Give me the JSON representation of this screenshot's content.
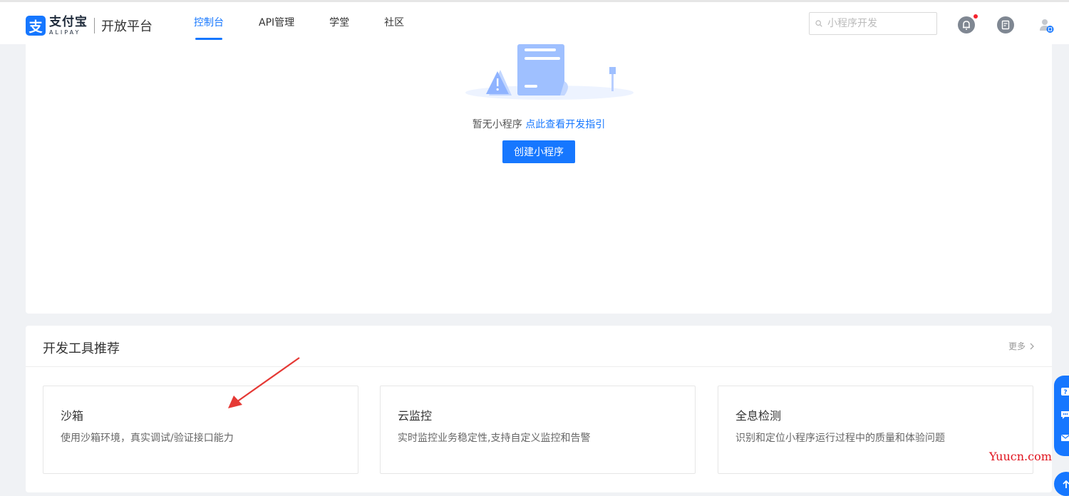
{
  "header": {
    "logo": {
      "cn": "支付宝",
      "en": "ALIPAY",
      "mark": "支",
      "platform": "开放平台"
    },
    "nav": [
      {
        "label": "控制台",
        "active": true
      },
      {
        "label": "API管理",
        "active": false
      },
      {
        "label": "学堂",
        "active": false
      },
      {
        "label": "社区",
        "active": false
      }
    ],
    "search": {
      "placeholder": "小程序开发",
      "value": ""
    },
    "icons": [
      "bell-icon",
      "document-icon",
      "user-icon"
    ],
    "notification_dot_color": "#f5222d"
  },
  "empty_state": {
    "text": "暂无小程序",
    "link": "点此查看开发指引",
    "create_button": "创建小程序"
  },
  "tools": {
    "title": "开发工具推荐",
    "more": "更多",
    "cards": [
      {
        "name": "沙箱",
        "desc": "使用沙箱环境，真实调试/验证接口能力"
      },
      {
        "name": "云监控",
        "desc": "实时监控业务稳定性,支持自定义监控和告警"
      },
      {
        "name": "全息检测",
        "desc": "识别和定位小程序运行过程中的质量和体验问题"
      }
    ]
  },
  "floating": {
    "icons": [
      "help-icon",
      "chat-icon",
      "mail-icon",
      "back-to-top-icon"
    ]
  },
  "watermark": "Yuucn.com",
  "colors": {
    "accent": "#1677ff",
    "background": "#f0f2f5",
    "annotation_arrow": "#e53935"
  }
}
